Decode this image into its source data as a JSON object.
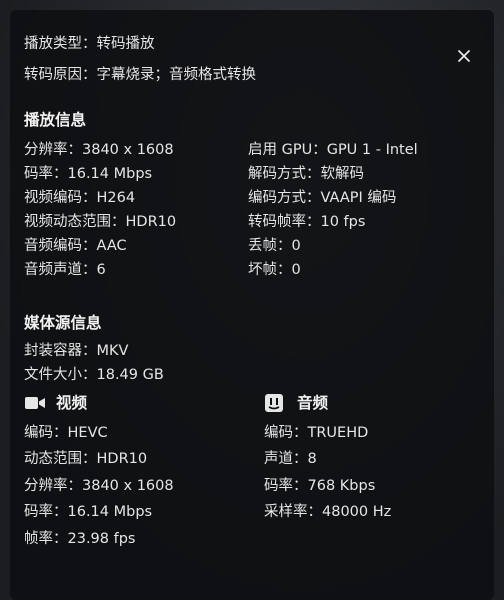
{
  "header": {
    "play_type": "播放类型：转码播放",
    "transcode_reason": "转码原因：字幕烧录；音频格式转换"
  },
  "playback_info": {
    "title": "播放信息",
    "left": [
      "分辨率：3840 x 1608",
      "码率：16.14 Mbps",
      "视频编码：H264",
      "视频动态范围：HDR10",
      "音频编码：AAC",
      "音频声道：6"
    ],
    "right": [
      "启用 GPU：GPU 1 - Intel",
      "解码方式：软解码",
      "编码方式：VAAPI 编码",
      "转码帧率：10 fps",
      "丢帧：0",
      "坏帧：0"
    ]
  },
  "media_info": {
    "title": "媒体源信息",
    "container": "封装容器：MKV",
    "file_size": "文件大小：18.49 GB"
  },
  "video": {
    "title": "视频",
    "icon": "video-camera-icon",
    "rows": [
      "编码：HEVC",
      "动态范围：HDR10",
      "分辨率：3840 x 1608",
      "码率：16.14 Mbps",
      "帧率：23.98 fps"
    ]
  },
  "audio": {
    "title": "音频",
    "icon": "audio-icon",
    "rows": [
      "编码：TRUEHD",
      "声道：8",
      "码率：768 Kbps",
      "采样率：48000 Hz"
    ]
  },
  "close": {
    "icon": "close-icon"
  },
  "colors": {
    "panel_bg": "#0e0f11",
    "text": "#e6e6e6"
  }
}
